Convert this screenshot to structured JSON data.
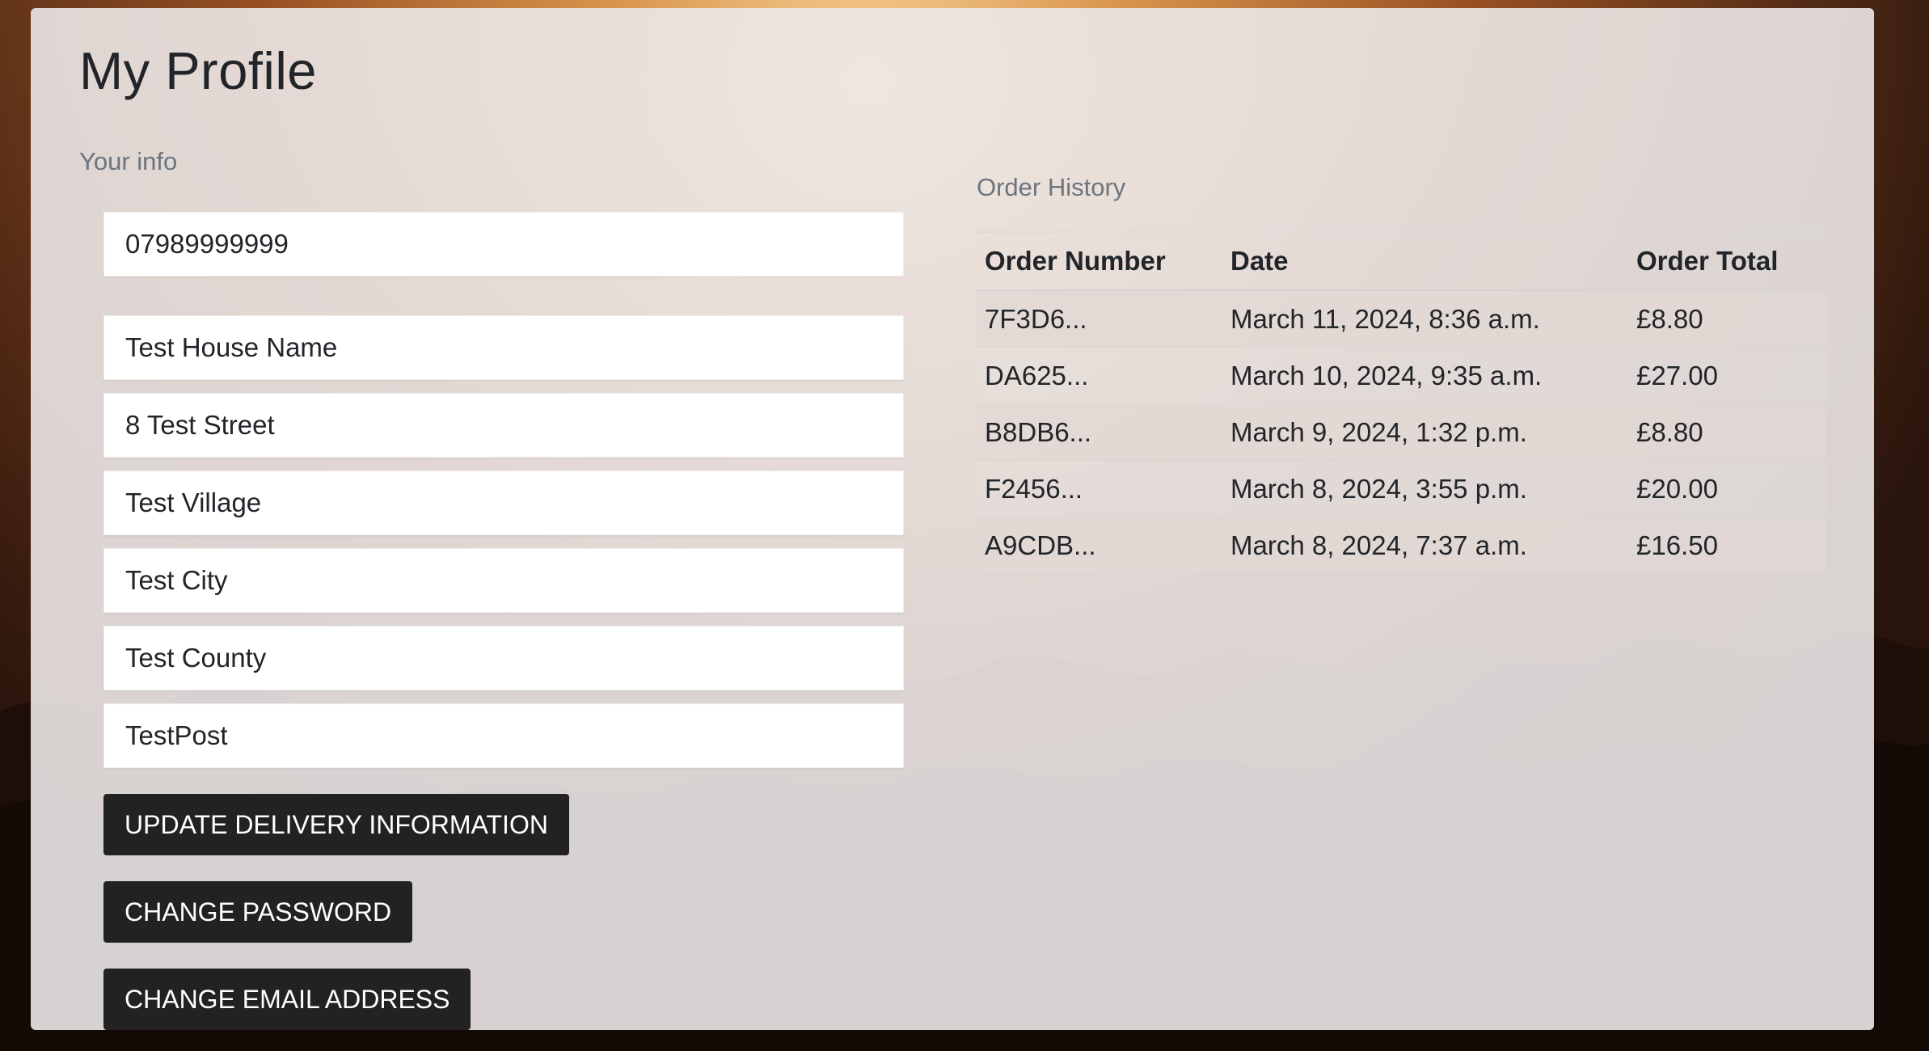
{
  "page": {
    "title": "My Profile"
  },
  "profile": {
    "section_label": "Your info",
    "fields": {
      "phone": "07989999999",
      "house_name": "Test House Name",
      "street": "8 Test Street",
      "village": "Test Village",
      "city": "Test City",
      "county": "Test County",
      "postcode": "TestPost"
    },
    "buttons": {
      "update_delivery": "UPDATE DELIVERY INFORMATION",
      "change_password": "CHANGE PASSWORD",
      "change_email": "CHANGE EMAIL ADDRESS"
    }
  },
  "order_history": {
    "section_label": "Order History",
    "columns": [
      "Order Number",
      "Date",
      "Order Total"
    ],
    "rows": [
      {
        "number": "7F3D6...",
        "date": "March 11, 2024, 8:36 a.m.",
        "total": "£8.80"
      },
      {
        "number": "DA625...",
        "date": "March 10, 2024, 9:35 a.m.",
        "total": "£27.00"
      },
      {
        "number": "B8DB6...",
        "date": "March 9, 2024, 1:32 p.m.",
        "total": "£8.80"
      },
      {
        "number": "F2456...",
        "date": "March 8, 2024, 3:55 p.m.",
        "total": "£20.00"
      },
      {
        "number": "A9CDB...",
        "date": "March 8, 2024, 7:37 a.m.",
        "total": "£16.50"
      }
    ]
  },
  "colors": {
    "button_bg": "#222222",
    "panel_bg": "#ece8e8",
    "text": "#212529",
    "muted": "#6c757d"
  }
}
